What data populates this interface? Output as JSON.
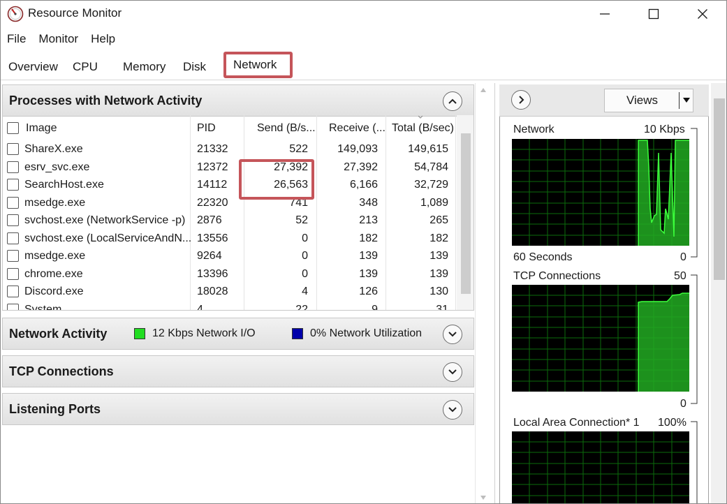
{
  "window": {
    "title": "Resource Monitor",
    "minimize_icon": "minimize-icon",
    "maximize_icon": "maximize-icon",
    "close_icon": "close-icon"
  },
  "menu": [
    "File",
    "Monitor",
    "Help"
  ],
  "tabs": {
    "items": [
      "Overview",
      "CPU",
      "Memory",
      "Disk"
    ],
    "active": "Network"
  },
  "processes": {
    "title": "Processes with Network Activity",
    "columns": [
      "Image",
      "PID",
      "Send (B/s...",
      "Receive (...",
      "Total (B/sec)"
    ],
    "rows": [
      {
        "image": "ShareX.exe",
        "pid": "21332",
        "send": "522",
        "receive": "149,093",
        "total": "149,615"
      },
      {
        "image": "esrv_svc.exe",
        "pid": "12372",
        "send": "27,392",
        "receive": "27,392",
        "total": "54,784"
      },
      {
        "image": "SearchHost.exe",
        "pid": "14112",
        "send": "26,563",
        "receive": "6,166",
        "total": "32,729"
      },
      {
        "image": "msedge.exe",
        "pid": "22320",
        "send": "741",
        "receive": "348",
        "total": "1,089"
      },
      {
        "image": "svchost.exe (NetworkService -p)",
        "pid": "2876",
        "send": "52",
        "receive": "213",
        "total": "265"
      },
      {
        "image": "svchost.exe (LocalServiceAndN...",
        "pid": "13556",
        "send": "0",
        "receive": "182",
        "total": "182"
      },
      {
        "image": "msedge.exe",
        "pid": "9264",
        "send": "0",
        "receive": "139",
        "total": "139"
      },
      {
        "image": "chrome.exe",
        "pid": "13396",
        "send": "0",
        "receive": "139",
        "total": "139"
      },
      {
        "image": "Discord.exe",
        "pid": "18028",
        "send": "4",
        "receive": "126",
        "total": "130"
      },
      {
        "image": "System",
        "pid": "4",
        "send": "22",
        "receive": "9",
        "total": "31"
      }
    ]
  },
  "network_activity": {
    "title": "Network Activity",
    "io_label": "12 Kbps Network I/O",
    "io_color": "#22dd22",
    "util_label": "0% Network Utilization",
    "util_color": "#0000aa"
  },
  "tcp_connections": {
    "title": "TCP Connections"
  },
  "listening_ports": {
    "title": "Listening Ports"
  },
  "right_panel": {
    "views_label": "Views",
    "graph_network": {
      "title": "Network",
      "max": "10 Kbps",
      "time": "60 Seconds",
      "min": "0"
    },
    "graph_tcp": {
      "title": "TCP Connections",
      "max": "50",
      "min": "0"
    },
    "graph_lan": {
      "title": "Local Area Connection* 1",
      "max": "100%"
    }
  }
}
